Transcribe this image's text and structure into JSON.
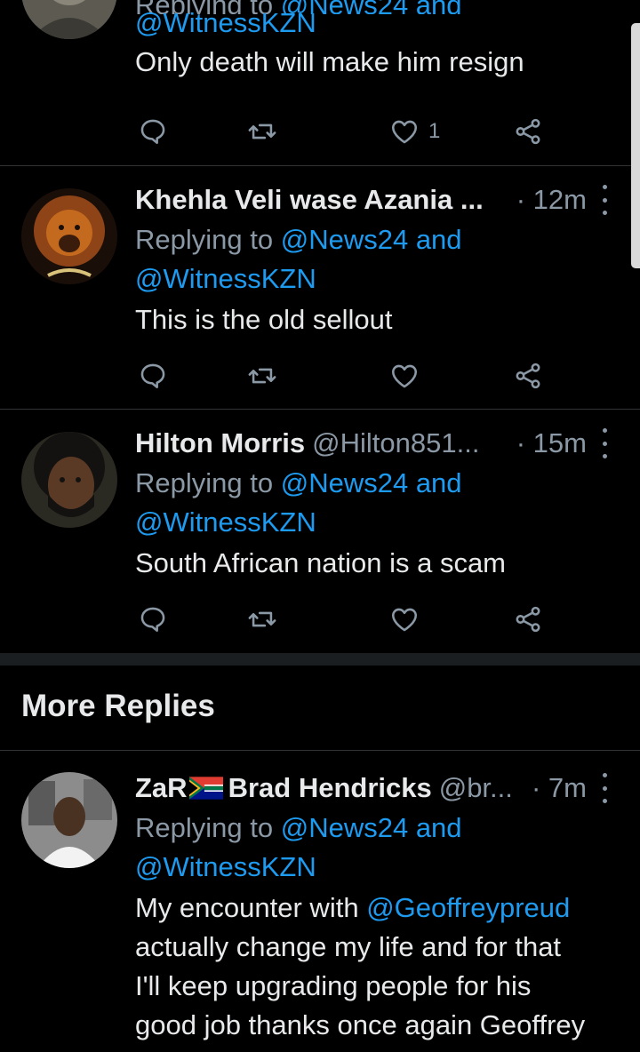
{
  "tweets": [
    {
      "reply_prefix": "Replying to",
      "mention_top_partial": "@News24 and",
      "mention_2": "@WitnessKZN",
      "text": "Only death will make him resign",
      "like_count": "1"
    },
    {
      "name": "Khehla Veli wase Azania ...",
      "time": "· 12m",
      "reply_prefix": "Replying to",
      "mention_1": "@News24",
      "and": "and",
      "mention_2": "@WitnessKZN",
      "text": "This is the old sellout"
    },
    {
      "name": "Hilton Morris",
      "handle": "@Hilton851...",
      "time": "· 15m",
      "reply_prefix": "Replying to",
      "mention_1": "@News24",
      "and": "and",
      "mention_2": "@WitnessKZN",
      "text": "South African nation is a scam"
    },
    {
      "name_prefix": "ZaR",
      "name": "Brad Hendricks",
      "handle": "@br...",
      "time": "· 7m",
      "reply_prefix": "Replying to",
      "mention_1": "@News24",
      "and": "and",
      "mention_2": "@WitnessKZN",
      "text_line1_start": "My encounter with",
      "text_line1_mention": "@Geoffreypreud",
      "text_line2": "actually change my life and for that",
      "text_line3": "I'll keep upgrading people for his",
      "text_line4": "good job thanks once again Geoffrey"
    }
  ],
  "more_replies_title": "More Replies",
  "icons": [
    "reply-icon",
    "retweet-icon",
    "like-icon",
    "share-icon",
    "more-icon",
    "south-africa-flag-icon"
  ],
  "colors": {
    "background": "#000000",
    "text": "#e7e9ea",
    "secondary": "#8b98a5",
    "link": "#1d9bf0",
    "divider": "#2f3336"
  }
}
